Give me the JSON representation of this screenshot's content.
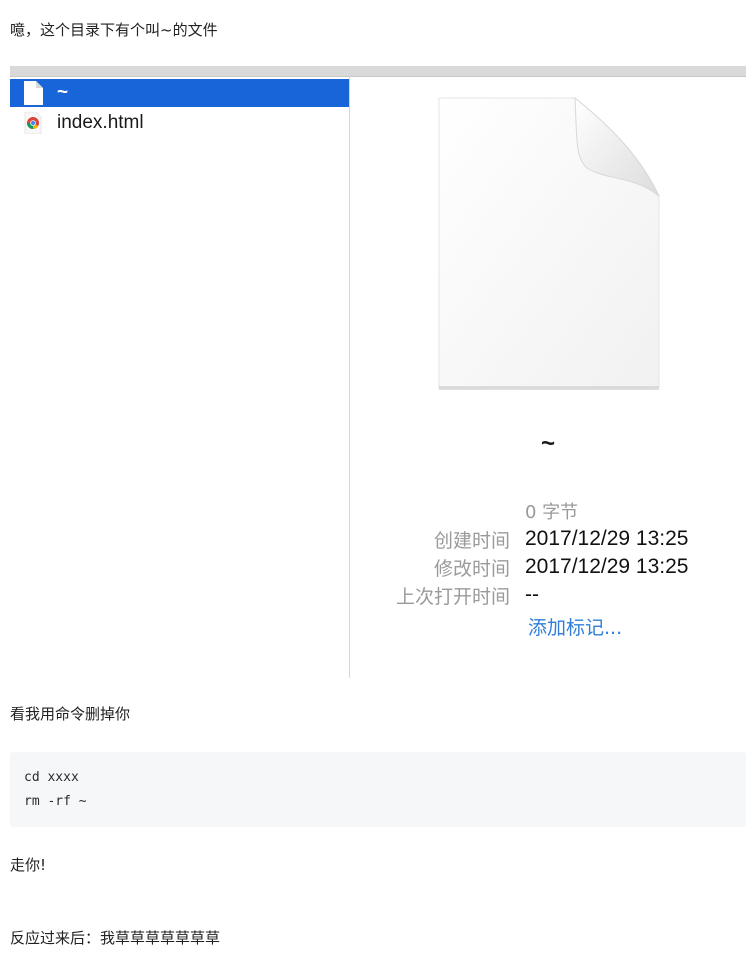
{
  "intro_text": "噫，这个目录下有个叫~的文件",
  "finder": {
    "files": [
      {
        "name": "~",
        "icon": "blank-document-icon",
        "selected": true
      },
      {
        "name": "index.html",
        "icon": "chrome-html-icon",
        "selected": false
      }
    ],
    "preview": {
      "icon": "blank-document-icon",
      "filename": "~",
      "size": "0 字节",
      "created_label": "创建时间",
      "created_value": "2017/12/29 13:25",
      "modified_label": "修改时间",
      "modified_value": "2017/12/29 13:25",
      "last_opened_label": "上次打开时间",
      "last_opened_value": "--",
      "add_tags": "添加标记..."
    },
    "colors": {
      "selection": "#1765d8",
      "link": "#2f7fd8",
      "label": "#9a9a9a"
    }
  },
  "command_intro": "看我用命令删掉你",
  "code_lines": [
    "cd xxxx",
    "rm -rf ~"
  ],
  "go_text": "走你!",
  "reaction_text": "反应过来后：我草草草草草草草"
}
